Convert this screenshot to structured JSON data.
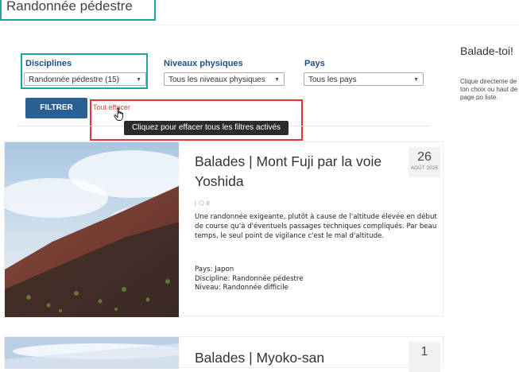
{
  "page": {
    "title": "Randonnée pédestre"
  },
  "filters": {
    "disciplines": {
      "label": "Disciplines",
      "value": "Randonnée pédestre (15)"
    },
    "niveaux": {
      "label": "Niveaux physiques",
      "value": "Tous les niveaux physiques"
    },
    "pays": {
      "label": "Pays",
      "value": "Tous les pays"
    },
    "filter_button": "FILTRER",
    "clear_link": "Tout effacer",
    "tooltip": "Cliquez pour effacer tous les filtres activés"
  },
  "sidebar": {
    "title": "Balade-toi!",
    "text": "Clique directeme de ton choix ou haut de page po liste."
  },
  "posts": [
    {
      "title": "Balades | Mont Fuji par la voie Yoshida",
      "day": "26",
      "month": "AOÛT 2025",
      "meta": "| 🗨 0",
      "excerpt": "Une randonnée exigeante, plutôt à cause de l'altitude élevée en début de course qu'à d'éventuels passages techniques compliqués. Par beau temps, le seul point de vigilance c'est le mal d'altitude.",
      "pays": "Pays: Japon",
      "discipline": "Discipline: Randonnée pédestre",
      "niveau": "Niveau: Randonnée difficile"
    },
    {
      "title": "Balades | Myoko-san",
      "day": "1"
    }
  ],
  "colors": {
    "accent": "#2a5f93",
    "label": "#1f4e88",
    "highlight_teal": "#1fa39a",
    "highlight_red": "#e53333",
    "link_red": "#e23b3b"
  }
}
